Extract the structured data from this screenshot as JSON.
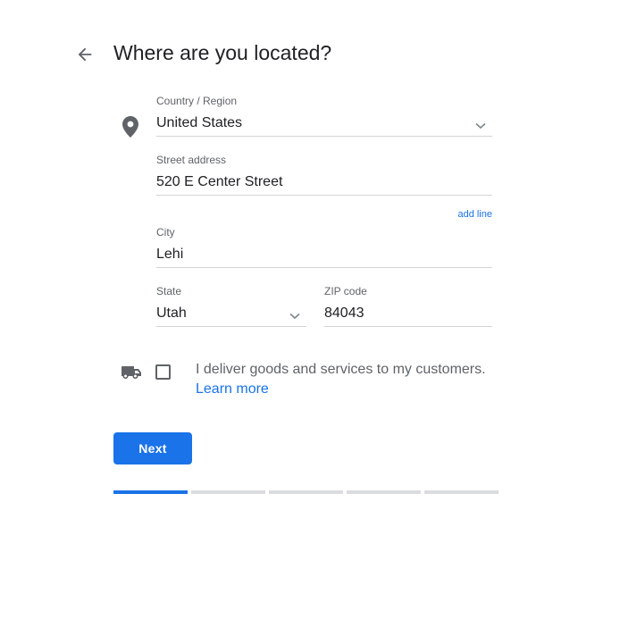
{
  "page": {
    "title": "Where are you located?"
  },
  "form": {
    "country": {
      "label": "Country / Region",
      "value": "United States"
    },
    "street": {
      "label": "Street address",
      "value": "520 E Center Street"
    },
    "add_line_label": "add line",
    "city": {
      "label": "City",
      "value": "Lehi"
    },
    "state": {
      "label": "State",
      "value": "Utah"
    },
    "zip": {
      "label": "ZIP code",
      "value": "84043"
    }
  },
  "delivery": {
    "text": "I deliver goods and services to my customers.",
    "learn_more": "Learn more",
    "checked": false
  },
  "actions": {
    "next_label": "Next"
  },
  "progress": {
    "total_steps": 5,
    "current_step": 1
  },
  "icons": {
    "back": "arrow-left-icon",
    "location": "map-pin-icon",
    "dropdown": "chevron-down-icon",
    "delivery": "truck-icon"
  },
  "colors": {
    "accent": "#1a73e8",
    "icon": "#5f6368",
    "text": "#202124",
    "muted_text": "#5f6368",
    "divider": "#d2d4d6",
    "progress_inactive": "#dadce0"
  }
}
